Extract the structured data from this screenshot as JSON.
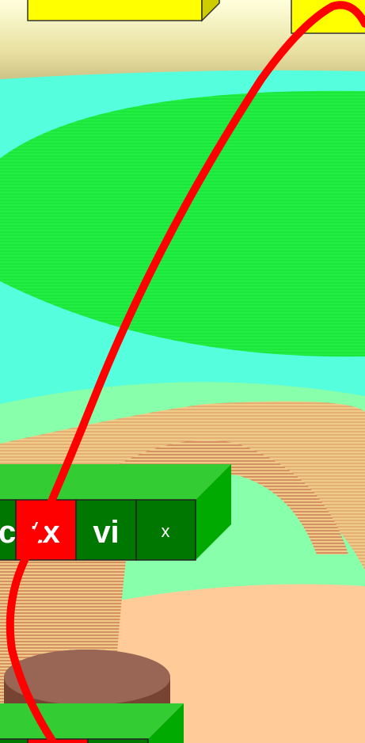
{
  "diagram": {
    "upper_bar": {
      "cells": [
        {
          "label": "c",
          "color": "#007700"
        },
        {
          "label": "tx",
          "color": "#ff0000"
        },
        {
          "label": "vi",
          "color": "#007700"
        },
        {
          "label": "x",
          "color": "#007700"
        }
      ]
    },
    "lower_bar": {
      "cells": [
        {
          "label": "",
          "color": "#007700"
        },
        {
          "label": "",
          "color": "#ff0000"
        },
        {
          "label": "",
          "color": "#007700"
        }
      ]
    },
    "colors": {
      "sky": "#55ffdd",
      "land": "#88ffaa",
      "green_blob": "#22ee44",
      "tan_band": "#eecc88",
      "peach": "#ffcc99",
      "brown_disk": "#996655",
      "yellow_box": "#ffff00",
      "bar_top": "#33cc33",
      "bar_side": "#00aa00",
      "curve": "#ff0000"
    }
  }
}
